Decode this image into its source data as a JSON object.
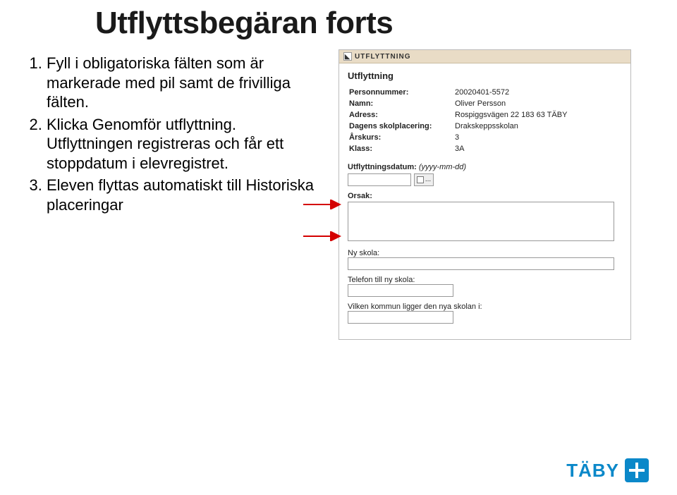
{
  "title": "Utflyttsbegäran forts",
  "instructions": [
    "Fyll i obligatoriska fälten som är markerade med pil samt de frivilliga fälten.",
    "Klicka Genomför utflyttning. Utflyttningen registreras och får ett stoppdatum i elevregistret.",
    "Eleven flyttas automatiskt till Historiska placeringar"
  ],
  "screenshot": {
    "header": "UTFLYTTNING",
    "section_title": "Utflyttning",
    "info": {
      "personnummer_label": "Personnummer:",
      "personnummer_value": "20020401-5572",
      "namn_label": "Namn:",
      "namn_value": "Oliver Persson",
      "adress_label": "Adress:",
      "adress_value": "Rospiggsvägen 22 183 63 TÄBY",
      "dagens_skolplacering_label": "Dagens skolplacering:",
      "dagens_skolplacering_value": "Drakskeppsskolan",
      "arskurs_label": "Årskurs:",
      "arskurs_value": "3",
      "klass_label": "Klass:",
      "klass_value": "3A"
    },
    "fields": {
      "utflyttning_label": "Utflyttningsdatum:",
      "utflyttning_hint": "(yyyy-mm-dd)",
      "date_button": "...",
      "orsak_label": "Orsak:",
      "ny_skola_label": "Ny skola:",
      "telefon_label": "Telefon till ny skola:",
      "kommun_label": "Vilken kommun ligger den nya skolan i:"
    }
  },
  "logo": "TÄBY"
}
